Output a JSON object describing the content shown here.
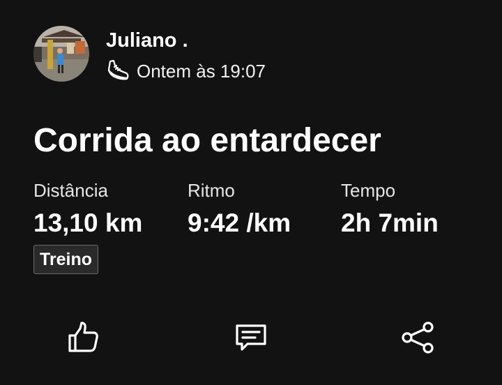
{
  "post": {
    "user_name": "Juliano .",
    "activity_icon": "running-shoe-icon",
    "timestamp": "Ontem às 19:07",
    "title": "Corrida ao entardecer"
  },
  "stats": {
    "distance": {
      "label": "Distância",
      "value": "13,10 km"
    },
    "pace": {
      "label": "Ritmo",
      "value": "9:42 /km"
    },
    "time": {
      "label": "Tempo",
      "value": "2h 7min"
    }
  },
  "tag": "Treino",
  "actions": {
    "like_icon": "thumbs-up-icon",
    "comment_icon": "comment-icon",
    "share_icon": "share-icon"
  },
  "colors": {
    "background": "#121212",
    "text": "#ffffff",
    "tag_border": "#6a6a6a",
    "tag_background": "#2a2a2a"
  }
}
